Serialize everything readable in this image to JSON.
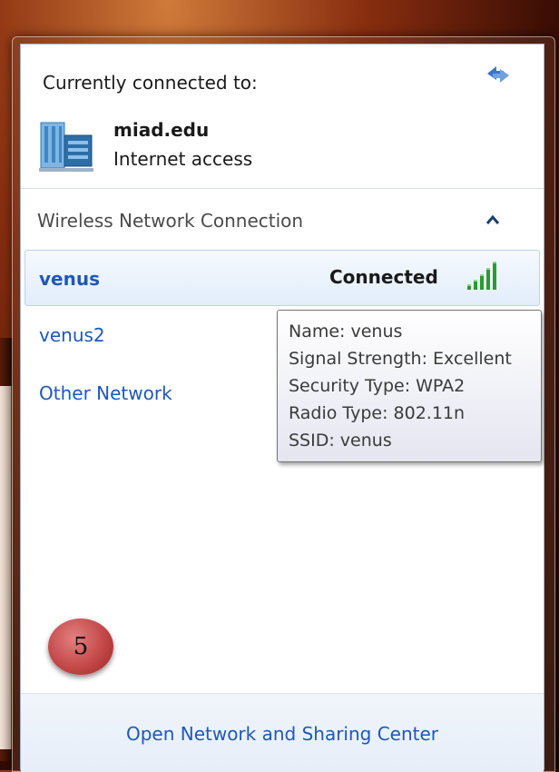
{
  "header": {
    "title": "Currently connected to:",
    "refresh_icon": "refresh-icon"
  },
  "current_network": {
    "name": "miad.edu",
    "access": "Internet access",
    "icon": "network-building-icon"
  },
  "section": {
    "title": "Wireless Network Connection",
    "collapse_icon": "chevron-up-icon"
  },
  "networks": [
    {
      "name": "venus",
      "status": "Connected",
      "signal_icon": "signal-strength-icon",
      "selected": true
    },
    {
      "name": "venus2"
    },
    {
      "name": "Other Network"
    }
  ],
  "tooltip": {
    "name": "Name: venus",
    "signal": "Signal Strength: Excellent",
    "security": "Security Type: WPA2",
    "radio": "Radio Type: 802.11n",
    "ssid": "SSID: venus"
  },
  "badge": {
    "step": "5"
  },
  "footer": {
    "link": "Open Network and Sharing Center"
  },
  "colors": {
    "link_blue": "#1e58b8",
    "badge_red": "#c44848",
    "signal_green": "#2e9a2e"
  }
}
